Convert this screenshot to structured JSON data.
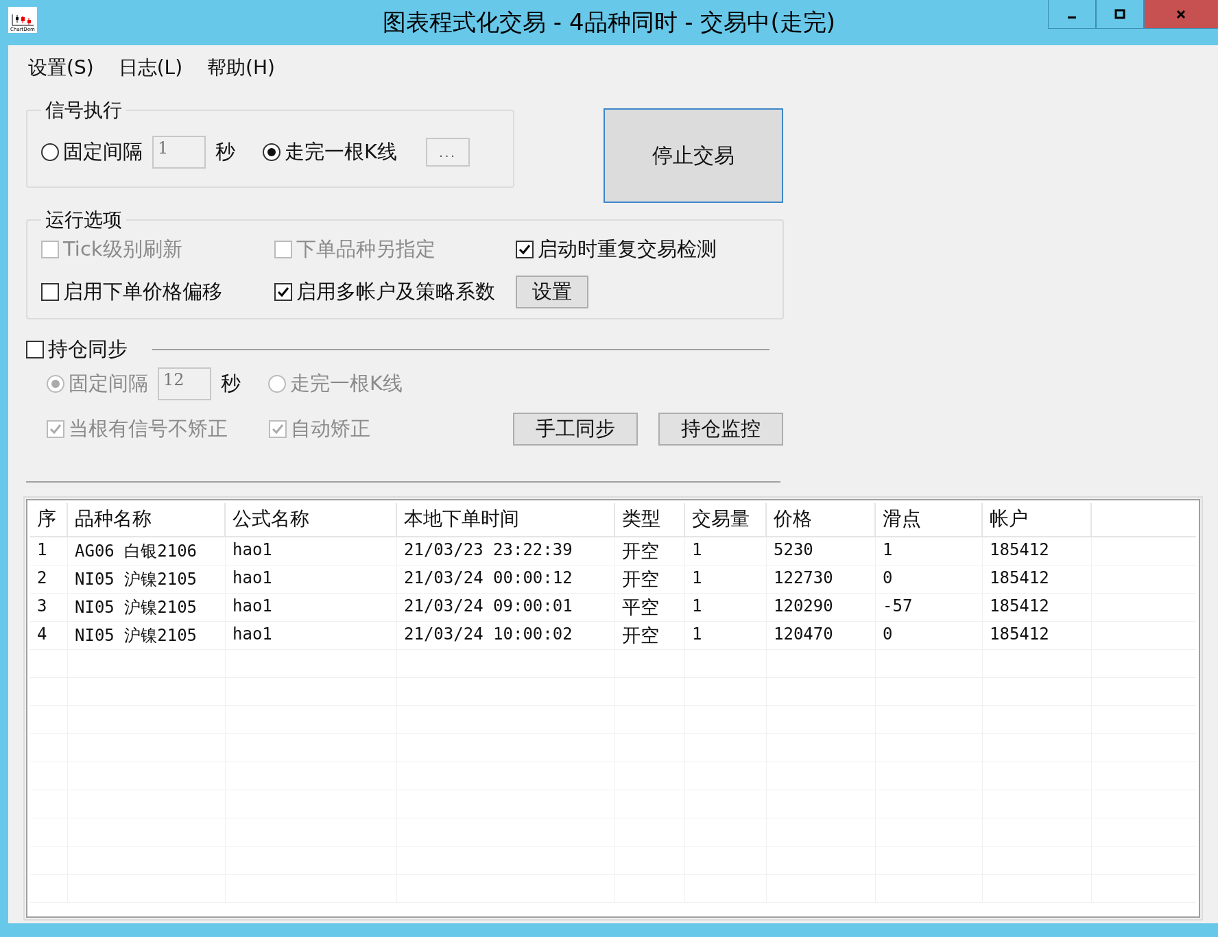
{
  "window": {
    "title": "图表程式化交易 - 4品种同时 - 交易中(走完)",
    "icon_label": "ChartDem"
  },
  "menu": [
    "设置(S)",
    "日志(L)",
    "帮助(H)"
  ],
  "signal_group": {
    "title": "信号执行",
    "interval_radio": {
      "label": "固定间隔",
      "selected": false
    },
    "interval_field": {
      "value": "1"
    },
    "unit": "秒",
    "bar_radio": {
      "label": "走完一根K线",
      "selected": true
    },
    "more_button": "..."
  },
  "stop_button": "停止交易",
  "run_options": {
    "title": "运行选项",
    "items": [
      {
        "kind": "checkbox",
        "label": "Tick级别刷新",
        "checked": false,
        "disabled": true
      },
      {
        "kind": "checkbox",
        "label": "下单品种另指定",
        "checked": false,
        "disabled": true
      },
      {
        "kind": "checkbox",
        "label": "启动时重复交易检测",
        "checked": true,
        "disabled": false
      },
      {
        "kind": "checkbox",
        "label": "启用下单价格偏移",
        "checked": false,
        "disabled": false
      },
      {
        "kind": "checkbox",
        "label": "启用多帐户及策略系数",
        "checked": true,
        "disabled": false
      },
      {
        "kind": "button",
        "label": "设置"
      }
    ]
  },
  "position_sync": {
    "label": "持仓同步",
    "checked": false,
    "interval_radio": {
      "label": "固定间隔",
      "selected": true
    },
    "interval_field": {
      "value": "12"
    },
    "unit": "秒",
    "bar_radio": {
      "label": "走完一根K线",
      "selected": false
    },
    "checks": [
      {
        "label": "当根有信号不矫正",
        "checked": true
      },
      {
        "label": "自动矫正",
        "checked": true
      }
    ],
    "buttons": [
      "手工同步",
      "持仓监控"
    ]
  },
  "table": {
    "columns": [
      "序",
      "品种名称",
      "公式名称",
      "本地下单时间",
      "类型",
      "交易量",
      "价格",
      "滑点",
      "帐户"
    ],
    "rows": [
      [
        "1",
        "AG06 白银2106",
        "hao1",
        "21/03/23 23:22:39",
        "开空",
        "1",
        "5230",
        "1",
        "185412"
      ],
      [
        "2",
        "NI05 沪镍2105",
        "hao1",
        "21/03/24 00:00:12",
        "开空",
        "1",
        "122730",
        "0",
        "185412"
      ],
      [
        "3",
        "NI05 沪镍2105",
        "hao1",
        "21/03/24 09:00:01",
        "平空",
        "1",
        "120290",
        "-57",
        "185412"
      ],
      [
        "4",
        "NI05 沪镍2105",
        "hao1",
        "21/03/24 10:00:02",
        "开空",
        "1",
        "120470",
        "0",
        "185412"
      ]
    ]
  }
}
